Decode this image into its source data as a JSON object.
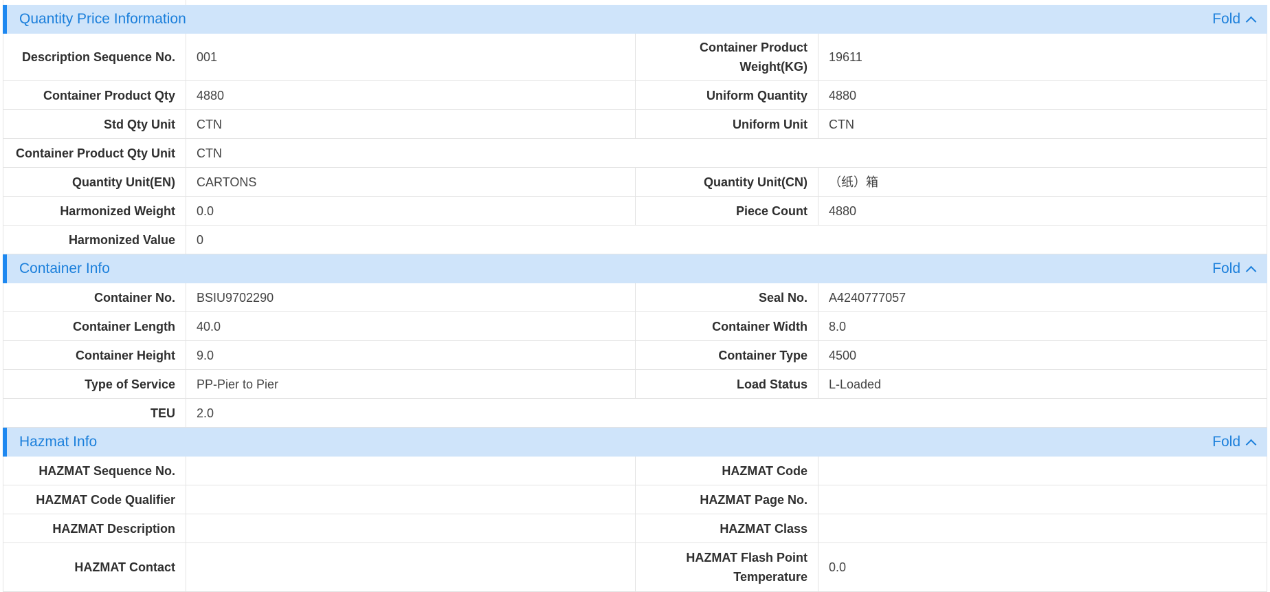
{
  "sections": [
    {
      "title": "Quantity Price Information",
      "fold_label": "Fold",
      "rows": [
        {
          "l1": "Description Sequence No.",
          "v1": "001",
          "l2": "Container Product Weight(KG)",
          "v2": "19611"
        },
        {
          "l1": "Container Product Qty",
          "v1": "4880",
          "l2": "Uniform Quantity",
          "v2": "4880"
        },
        {
          "l1": "Std Qty Unit",
          "v1": "CTN",
          "l2": "Uniform Unit",
          "v2": "CTN"
        },
        {
          "l1": "Container Product Qty Unit",
          "v1": "CTN"
        },
        {
          "l1": "Quantity Unit(EN)",
          "v1": "CARTONS",
          "l2": "Quantity Unit(CN)",
          "v2": "（纸）箱"
        },
        {
          "l1": "Harmonized Weight",
          "v1": "0.0",
          "l2": "Piece Count",
          "v2": "4880"
        },
        {
          "l1": "Harmonized Value",
          "v1": "0"
        }
      ]
    },
    {
      "title": "Container Info",
      "fold_label": "Fold",
      "rows": [
        {
          "l1": "Container No.",
          "v1": "BSIU9702290",
          "l2": "Seal No.",
          "v2": "A4240777057"
        },
        {
          "l1": "Container Length",
          "v1": "40.0",
          "l2": "Container Width",
          "v2": "8.0"
        },
        {
          "l1": "Container Height",
          "v1": "9.0",
          "l2": "Container Type",
          "v2": "4500"
        },
        {
          "l1": "Type of Service",
          "v1": "PP-Pier to Pier",
          "l2": "Load Status",
          "v2": "L-Loaded"
        },
        {
          "l1": "TEU",
          "v1": "2.0"
        }
      ]
    },
    {
      "title": "Hazmat Info",
      "fold_label": "Fold",
      "rows": [
        {
          "l1": "HAZMAT Sequence No.",
          "v1": "",
          "l2": "HAZMAT Code",
          "v2": ""
        },
        {
          "l1": "HAZMAT Code Qualifier",
          "v1": "",
          "l2": "HAZMAT Page No.",
          "v2": ""
        },
        {
          "l1": "HAZMAT Description",
          "v1": "",
          "l2": "HAZMAT Class",
          "v2": ""
        },
        {
          "l1": "HAZMAT Contact",
          "v1": "",
          "l2": "HAZMAT Flash Point Temperature",
          "v2": "0.0"
        }
      ]
    }
  ],
  "colors": {
    "header_bg": "#cfe4fa",
    "accent": "#1e88f0",
    "title_text": "#1b7fdb",
    "border": "#e3e3e3"
  },
  "icons": {
    "fold": "chevron-up-icon"
  }
}
